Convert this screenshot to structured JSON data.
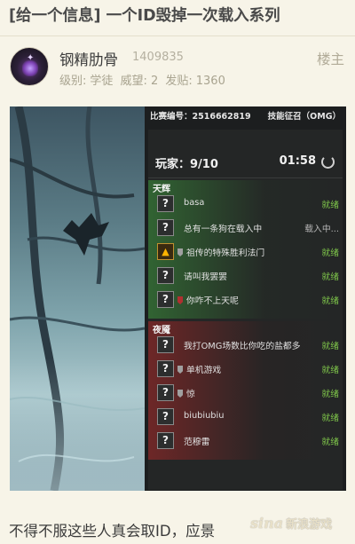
{
  "thread": {
    "title": "[给一个信息] 一个ID毁掉一次载入系列"
  },
  "post": {
    "username": "钢精肋骨",
    "user_id": "1409835",
    "floor": "楼主",
    "level_label": "级别:",
    "level_value": "学徒",
    "prestige_label": "威望:",
    "prestige_value": "2",
    "posts_label": "发贴:",
    "posts_value": "1360",
    "bottom_text": "不得不服这些人真会取ID，应景"
  },
  "screenshot": {
    "match_id": "比赛编号：2516662819",
    "skill_recruit": "技能征召（OMG）",
    "players": "玩家：9/10",
    "timer": "01:58",
    "radiant": {
      "name": "天辉",
      "players": [
        {
          "hero": "?",
          "name": "basa",
          "status": "就绪"
        },
        {
          "hero": "?",
          "name": "总有一条狗在载入中",
          "status": "载入中..."
        },
        {
          "hero": "emblem",
          "name": "祖传的特殊胜利法门",
          "status": "就绪"
        },
        {
          "hero": "?",
          "name": "请叫我罢罢",
          "status": "就绪"
        },
        {
          "hero": "?",
          "name": "你咋不上天呢",
          "status": "就绪"
        }
      ]
    },
    "dire": {
      "name": "夜魇",
      "players": [
        {
          "hero": "?",
          "name": "我打OMG场数比你吃的盐都多",
          "status": "就绪"
        },
        {
          "hero": "?",
          "name": "单机游戏",
          "status": "就绪"
        },
        {
          "hero": "?",
          "name": "惊",
          "status": "就绪"
        },
        {
          "hero": "?",
          "name": "biubiubiu",
          "status": "就绪"
        },
        {
          "hero": "?",
          "name": "范穆雷",
          "status": "就绪"
        }
      ]
    }
  },
  "watermark": {
    "logo": "sina",
    "text": "新浪游戏"
  }
}
